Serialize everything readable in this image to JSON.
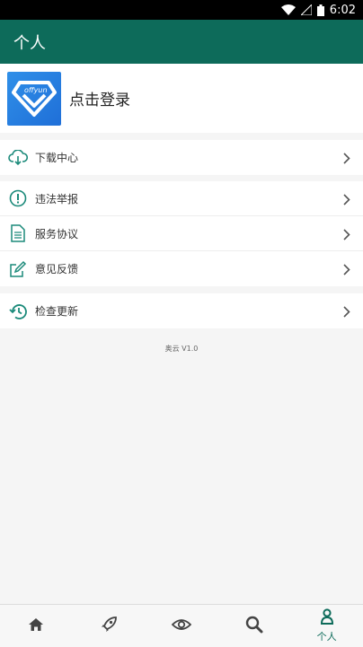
{
  "status_bar": {
    "time": "6:02"
  },
  "app_bar": {
    "title": "个人"
  },
  "profile": {
    "login_label": "点击登录",
    "avatar_text": "offyun"
  },
  "menu_groups": [
    [
      {
        "label": "下载中心",
        "icon": "cloud-download-icon"
      }
    ],
    [
      {
        "label": "违法举报",
        "icon": "alert-icon"
      },
      {
        "label": "服务协议",
        "icon": "document-icon"
      },
      {
        "label": "意见反馈",
        "icon": "edit-icon"
      }
    ],
    [
      {
        "label": "检查更新",
        "icon": "history-icon"
      }
    ]
  ],
  "version": "奥云 V1.0",
  "bottom_nav": [
    {
      "icon": "home-icon",
      "label": ""
    },
    {
      "icon": "rocket-icon",
      "label": ""
    },
    {
      "icon": "eye-icon",
      "label": ""
    },
    {
      "icon": "search-icon",
      "label": ""
    },
    {
      "icon": "person-icon",
      "label": "个人"
    }
  ],
  "colors": {
    "primary": "#0d6b5a",
    "accent": "#1b8a7a"
  }
}
